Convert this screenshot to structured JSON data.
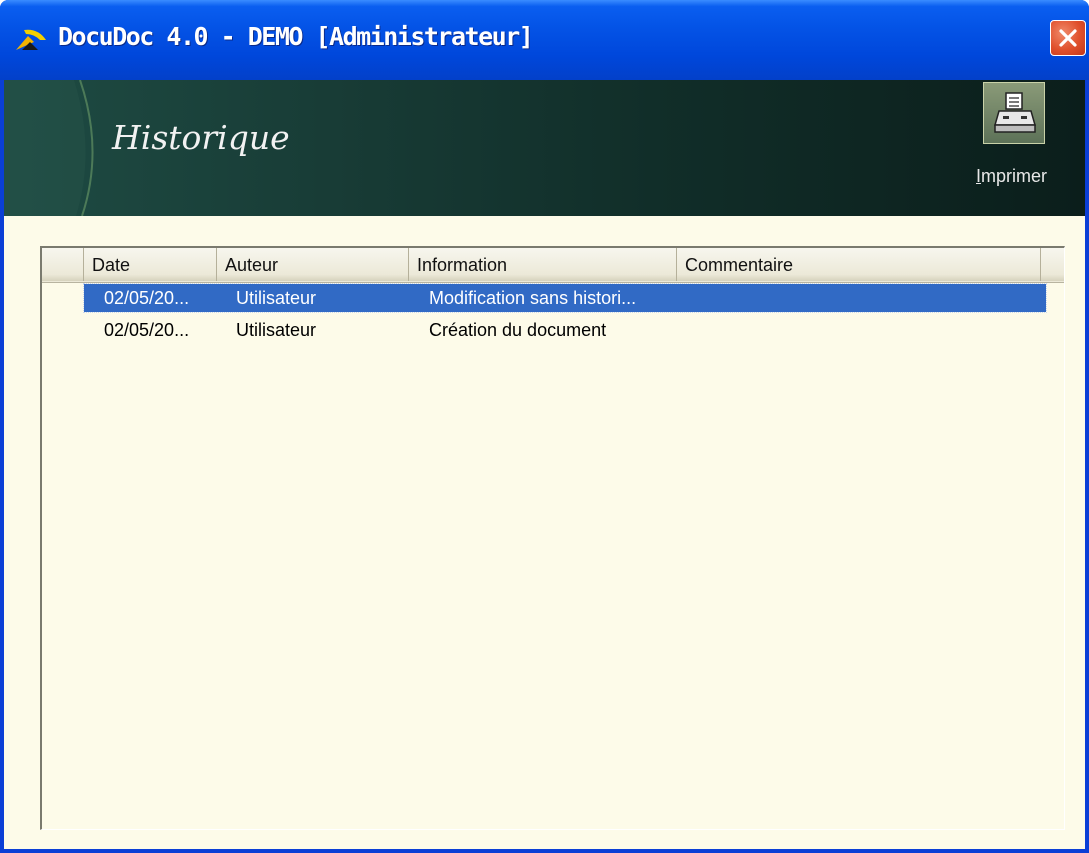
{
  "window": {
    "title": "DocuDoc 4.0 - DEMO [Administrateur]",
    "accent_color": "#0047db",
    "close_color": "#e0502c"
  },
  "banner": {
    "title": "Historique",
    "print_button": {
      "label_first": "I",
      "label_rest": "mprimer",
      "icon": "printer-icon"
    }
  },
  "history_list": {
    "columns": [
      "Date",
      "Auteur",
      "Information",
      "Commentaire"
    ],
    "rows": [
      {
        "date": "02/05/20...",
        "author": "Utilisateur",
        "information": "Modification sans histori...",
        "comment": "",
        "selected": true
      },
      {
        "date": "02/05/20...",
        "author": "Utilisateur",
        "information": "Création du document",
        "comment": "",
        "selected": false
      }
    ],
    "selection_color": "#316ac5",
    "background_color": "#fdfbe9"
  }
}
